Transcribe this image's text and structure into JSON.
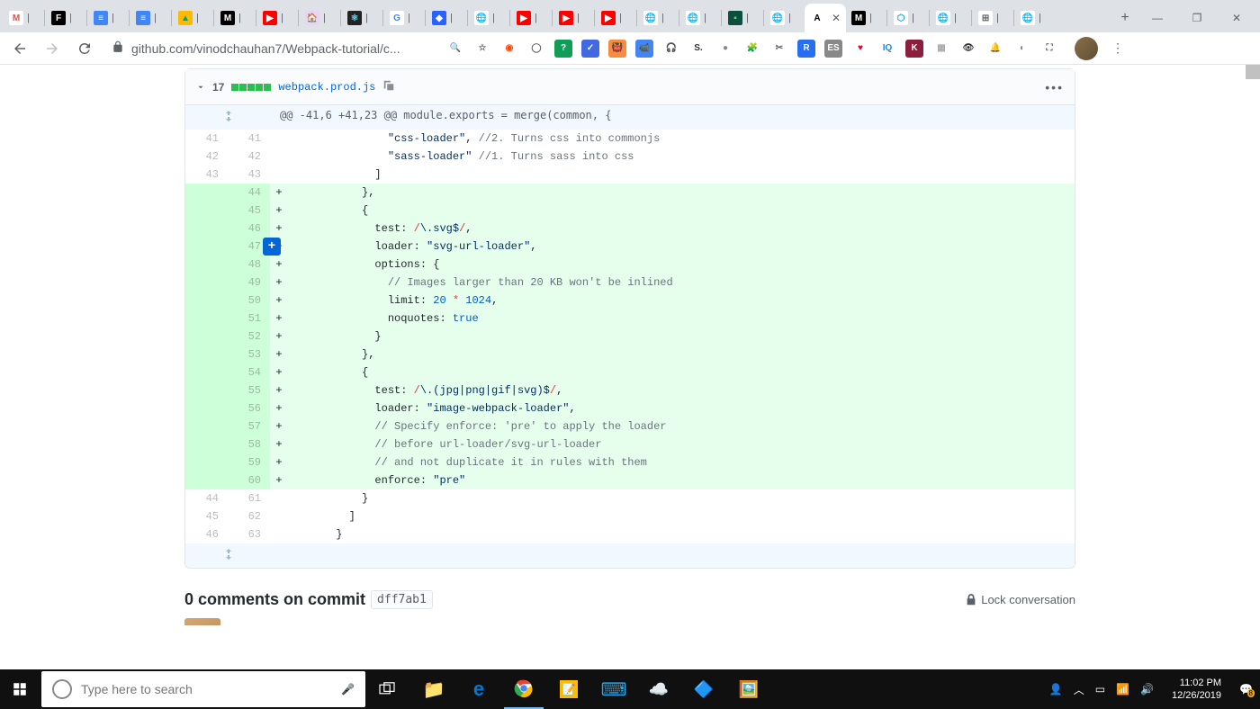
{
  "browser": {
    "url": "github.com/vinodchauhan7/Webpack-tutorial/c...",
    "active_tab_label": "A",
    "tabs_visible": 23
  },
  "file": {
    "name": "webpack.prod.js",
    "diffstat": "17",
    "hunk_header": "@@ -41,6 +41,23 @@ module.exports = merge(common, {"
  },
  "lines": [
    {
      "old": "41",
      "new": "41",
      "type": "ctx",
      "marker": "",
      "html": "              <span class='tok-str'>\"css-loader\"</span>, <span class='tok-cmt'>//2. Turns css into commonjs</span>"
    },
    {
      "old": "42",
      "new": "42",
      "type": "ctx",
      "marker": "",
      "html": "              <span class='tok-str'>\"sass-loader\"</span> <span class='tok-cmt'>//1. Turns sass into css</span>"
    },
    {
      "old": "43",
      "new": "43",
      "type": "ctx",
      "marker": "",
      "html": "            ]"
    },
    {
      "old": "",
      "new": "44",
      "type": "add",
      "marker": "+",
      "html": "          },"
    },
    {
      "old": "",
      "new": "45",
      "type": "add",
      "marker": "+",
      "html": "          {"
    },
    {
      "old": "",
      "new": "46",
      "type": "add",
      "marker": "+",
      "html": "            <span class='tok-prop'>test</span>: <span class='tok-kwd'>/</span><span class='tok-str'>\\.svg$</span><span class='tok-kwd'>/</span>,"
    },
    {
      "old": "",
      "new": "47",
      "type": "add",
      "marker": "+",
      "html": "            <span class='tok-prop'>loader</span>: <span class='tok-str'>\"svg-url-loader\"</span>,",
      "hasAddBtn": true
    },
    {
      "old": "",
      "new": "48",
      "type": "add",
      "marker": "+",
      "html": "            <span class='tok-prop'>options</span>: {"
    },
    {
      "old": "",
      "new": "49",
      "type": "add",
      "marker": "+",
      "html": "              <span class='tok-cmt'>// Images larger than 20 KB won't be inlined</span>"
    },
    {
      "old": "",
      "new": "50",
      "type": "add",
      "marker": "+",
      "html": "              <span class='tok-prop'>limit</span>: <span class='tok-num'>20</span> <span class='tok-kwd'>*</span> <span class='tok-num'>1024</span>,"
    },
    {
      "old": "",
      "new": "51",
      "type": "add",
      "marker": "+",
      "html": "              <span class='tok-prop'>noquotes</span>: <span class='tok-bool'>true</span>"
    },
    {
      "old": "",
      "new": "52",
      "type": "add",
      "marker": "+",
      "html": "            }"
    },
    {
      "old": "",
      "new": "53",
      "type": "add",
      "marker": "+",
      "html": "          },"
    },
    {
      "old": "",
      "new": "54",
      "type": "add",
      "marker": "+",
      "html": "          {"
    },
    {
      "old": "",
      "new": "55",
      "type": "add",
      "marker": "+",
      "html": "            <span class='tok-prop'>test</span>: <span class='tok-kwd'>/</span><span class='tok-str'>\\.(jpg|png|gif|svg)$</span><span class='tok-kwd'>/</span>,"
    },
    {
      "old": "",
      "new": "56",
      "type": "add",
      "marker": "+",
      "html": "            <span class='tok-prop'>loader</span>: <span class='tok-str'>\"image-webpack-loader\"</span>,"
    },
    {
      "old": "",
      "new": "57",
      "type": "add",
      "marker": "+",
      "html": "            <span class='tok-cmt'>// Specify enforce: 'pre' to apply the loader</span>"
    },
    {
      "old": "",
      "new": "58",
      "type": "add",
      "marker": "+",
      "html": "            <span class='tok-cmt'>// before url-loader/svg-url-loader</span>"
    },
    {
      "old": "",
      "new": "59",
      "type": "add",
      "marker": "+",
      "html": "            <span class='tok-cmt'>// and not duplicate it in rules with them</span>"
    },
    {
      "old": "",
      "new": "60",
      "type": "add",
      "marker": "+",
      "html": "            <span class='tok-prop'>enforce</span>: <span class='tok-str'>\"pre\"</span>"
    },
    {
      "old": "44",
      "new": "61",
      "type": "ctx",
      "marker": "",
      "html": "          }"
    },
    {
      "old": "45",
      "new": "62",
      "type": "ctx",
      "marker": "",
      "html": "        ]"
    },
    {
      "old": "46",
      "new": "63",
      "type": "ctx",
      "marker": "",
      "html": "      }"
    }
  ],
  "comments": {
    "title": "0 comments on commit",
    "sha": "dff7ab1",
    "lock_label": "Lock conversation"
  },
  "taskbar": {
    "search_placeholder": "Type here to search",
    "time": "11:02 PM",
    "date": "12/26/2019"
  },
  "tab_favicons": [
    {
      "bg": "#fff",
      "txt": "M",
      "color": "#de5246"
    },
    {
      "bg": "#000",
      "txt": "F",
      "color": "#fff"
    },
    {
      "bg": "#4285f4",
      "txt": "≡",
      "color": "#fff"
    },
    {
      "bg": "#4285f4",
      "txt": "≡",
      "color": "#fff"
    },
    {
      "bg": "#ffba00",
      "txt": "▲",
      "color": "#0f9d58"
    },
    {
      "bg": "#000",
      "txt": "M",
      "color": "#fff"
    },
    {
      "bg": "#f00",
      "txt": "▶",
      "color": "#fff"
    },
    {
      "bg": "#e6d6f5",
      "txt": "🏠",
      "color": "#000"
    },
    {
      "bg": "#222",
      "txt": "⚛",
      "color": "#61dafb"
    },
    {
      "bg": "#fff",
      "txt": "G",
      "color": "#4285f4"
    },
    {
      "bg": "#2962ff",
      "txt": "◆",
      "color": "#fff"
    },
    {
      "bg": "#fff",
      "txt": "🌐",
      "color": "#5f6368"
    },
    {
      "bg": "#f00",
      "txt": "▶",
      "color": "#fff"
    },
    {
      "bg": "#f00",
      "txt": "▶",
      "color": "#fff"
    },
    {
      "bg": "#f00",
      "txt": "▶",
      "color": "#fff"
    },
    {
      "bg": "#fff",
      "txt": "🌐",
      "color": "#5f6368"
    },
    {
      "bg": "#fff",
      "txt": "🌐",
      "color": "#5f6368"
    },
    {
      "bg": "#0d4f3c",
      "txt": "▪",
      "color": "#4ade80"
    },
    {
      "bg": "#fff",
      "txt": "🌐",
      "color": "#5f6368"
    },
    {
      "bg": "#fff",
      "txt": "A",
      "color": "#000",
      "active": true
    },
    {
      "bg": "#000",
      "txt": "M",
      "color": "#fff"
    },
    {
      "bg": "#fff",
      "txt": "⬡",
      "color": "#1ba1e2"
    },
    {
      "bg": "#fff",
      "txt": "🌐",
      "color": "#5f6368"
    },
    {
      "bg": "#fff",
      "txt": "⊞",
      "color": "#5f6368"
    },
    {
      "bg": "#fff",
      "txt": "🌐",
      "color": "#5f6368"
    }
  ],
  "ext_icons": [
    {
      "bg": "transparent",
      "txt": "🔍",
      "color": "#5f6368"
    },
    {
      "bg": "transparent",
      "txt": "☆",
      "color": "#5f6368"
    },
    {
      "bg": "transparent",
      "txt": "◉",
      "color": "#ff4500"
    },
    {
      "bg": "transparent",
      "txt": "◯",
      "color": "#5f6368"
    },
    {
      "bg": "#0f9d58",
      "txt": "?",
      "color": "#fff"
    },
    {
      "bg": "#4169e1",
      "txt": "✓",
      "color": "#fff"
    },
    {
      "bg": "#f78c40",
      "txt": "👹",
      "color": "#000"
    },
    {
      "bg": "#4285f4",
      "txt": "📹",
      "color": "#fff"
    },
    {
      "bg": "transparent",
      "txt": "🎧",
      "color": "#888"
    },
    {
      "bg": "transparent",
      "txt": "S.",
      "color": "#333"
    },
    {
      "bg": "transparent",
      "txt": "●",
      "color": "#888"
    },
    {
      "bg": "transparent",
      "txt": "🧩",
      "color": "#3b82f6"
    },
    {
      "bg": "transparent",
      "txt": "✂",
      "color": "#5f6368"
    },
    {
      "bg": "#276ef1",
      "txt": "R",
      "color": "#fff"
    },
    {
      "bg": "#888",
      "txt": "ES",
      "color": "#fff"
    },
    {
      "bg": "transparent",
      "txt": "♥",
      "color": "#e60023"
    },
    {
      "bg": "transparent",
      "txt": "IQ",
      "color": "#1e88e5"
    },
    {
      "bg": "#8b1e3f",
      "txt": "K",
      "color": "#fff"
    },
    {
      "bg": "transparent",
      "txt": "▦",
      "color": "#aaa"
    },
    {
      "bg": "transparent",
      "txt": "👁",
      "color": "#333"
    },
    {
      "bg": "transparent",
      "txt": "🔔",
      "color": "#d93025"
    },
    {
      "bg": "transparent",
      "txt": "◐",
      "color": "#888"
    },
    {
      "bg": "transparent",
      "txt": "⛶",
      "color": "#5f6368"
    }
  ]
}
